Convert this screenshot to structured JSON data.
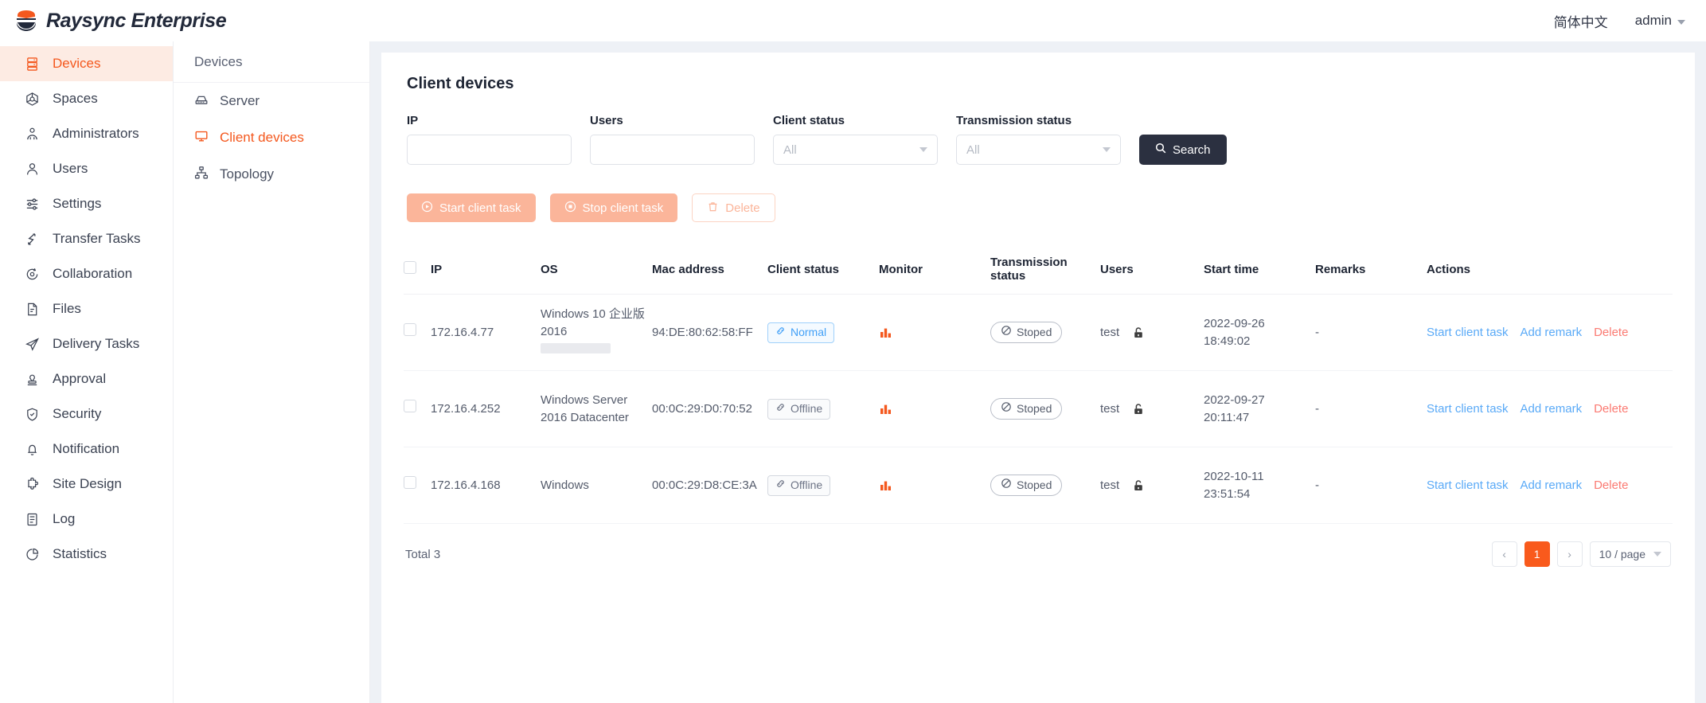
{
  "header": {
    "brand": "Raysync Enterprise",
    "logo_icon": "raysync-logo-icon",
    "language": "简体中文",
    "account": "admin",
    "account_caret_icon": "caret-down-icon"
  },
  "sidebar": {
    "items": [
      {
        "label": "Devices",
        "icon": "server-rack-icon",
        "active": true
      },
      {
        "label": "Spaces",
        "icon": "hexagon-cube-icon",
        "active": false
      },
      {
        "label": "Administrators",
        "icon": "users-group-icon",
        "active": false
      },
      {
        "label": "Users",
        "icon": "user-icon",
        "active": false
      },
      {
        "label": "Settings",
        "icon": "sliders-icon",
        "active": false
      },
      {
        "label": "Transfer Tasks",
        "icon": "transfer-icon",
        "active": false
      },
      {
        "label": "Collaboration",
        "icon": "sync-circle-icon",
        "active": false
      },
      {
        "label": "Files",
        "icon": "file-icon",
        "active": false
      },
      {
        "label": "Delivery Tasks",
        "icon": "paper-plane-icon",
        "active": false
      },
      {
        "label": "Approval",
        "icon": "stamp-icon",
        "active": false
      },
      {
        "label": "Security",
        "icon": "shield-check-icon",
        "active": false
      },
      {
        "label": "Notification",
        "icon": "bell-icon",
        "active": false
      },
      {
        "label": "Site Design",
        "icon": "puzzle-icon",
        "active": false
      },
      {
        "label": "Log",
        "icon": "log-list-icon",
        "active": false
      },
      {
        "label": "Statistics",
        "icon": "pie-chart-icon",
        "active": false
      }
    ]
  },
  "subnav": {
    "title": "Devices",
    "items": [
      {
        "label": "Server",
        "icon": "server-icon",
        "active": false
      },
      {
        "label": "Client devices",
        "icon": "monitor-icon",
        "active": true
      },
      {
        "label": "Topology",
        "icon": "topology-icon",
        "active": false
      }
    ]
  },
  "main": {
    "page_title": "Client devices",
    "filters": {
      "ip": {
        "label": "IP",
        "value": "",
        "placeholder": ""
      },
      "users": {
        "label": "Users",
        "value": "",
        "placeholder": ""
      },
      "client_status": {
        "label": "Client status",
        "value": "All",
        "options": [
          "All"
        ]
      },
      "transmission_status": {
        "label": "Transmission status",
        "value": "All",
        "options": [
          "All"
        ]
      },
      "search_button": {
        "label": "Search",
        "icon": "search-icon"
      }
    },
    "bulk_actions": [
      {
        "label": "Start client task",
        "icon": "play-circle-icon",
        "style": "primary-dis"
      },
      {
        "label": "Stop client task",
        "icon": "stop-circle-icon",
        "style": "primary-dis"
      },
      {
        "label": "Delete",
        "icon": "trash-icon",
        "style": "ghost-dis"
      }
    ],
    "table": {
      "columns": [
        "IP",
        "OS",
        "Mac address",
        "Client status",
        "Monitor",
        "Transmission status",
        "Users",
        "Start time",
        "Remarks",
        "Actions"
      ],
      "select_all_checked": false,
      "rows": [
        {
          "checked": false,
          "ip": "172.16.4.77",
          "os": "Windows 10 企业版 2016",
          "os_redacted": true,
          "mac": "94:DE:80:62:58:FF",
          "client_status": "Normal",
          "client_status_kind": "normal",
          "monitor_icon": "bar-chart-icon",
          "transmission_status": "Stoped",
          "user": "test",
          "user_lock_icon": "unlock-icon",
          "start_time": "2022-09-26 18:49:02",
          "remarks": "-",
          "actions": [
            "Start client task",
            "Add remark",
            "Delete"
          ]
        },
        {
          "checked": false,
          "ip": "172.16.4.252",
          "os": "Windows Server 2016 Datacenter",
          "os_redacted": false,
          "mac": "00:0C:29:D0:70:52",
          "client_status": "Offline",
          "client_status_kind": "offline",
          "monitor_icon": "bar-chart-icon",
          "transmission_status": "Stoped",
          "user": "test",
          "user_lock_icon": "unlock-icon",
          "start_time": "2022-09-27 20:11:47",
          "remarks": "-",
          "actions": [
            "Start client task",
            "Add remark",
            "Delete"
          ]
        },
        {
          "checked": false,
          "ip": "172.16.4.168",
          "os": "Windows",
          "os_redacted": false,
          "mac": "00:0C:29:D8:CE:3A",
          "client_status": "Offline",
          "client_status_kind": "offline",
          "monitor_icon": "bar-chart-icon",
          "transmission_status": "Stoped",
          "user": "test",
          "user_lock_icon": "unlock-icon",
          "start_time": "2022-10-11 23:51:54",
          "remarks": "-",
          "actions": [
            "Start client task",
            "Add remark",
            "Delete"
          ]
        }
      ]
    },
    "footer": {
      "total": "Total 3",
      "prev_icon": "chevron-left-icon",
      "next_icon": "chevron-right-icon",
      "pages": [
        "1"
      ],
      "current_page": "1",
      "page_size": "10 / page",
      "page_size_caret_icon": "chevron-down-icon"
    }
  },
  "colors": {
    "accent": "#f95a1c",
    "accent_soft": "#fdebe3",
    "link": "#5aaaf7",
    "danger": "#fb7a72",
    "dark": "#2b3040"
  }
}
